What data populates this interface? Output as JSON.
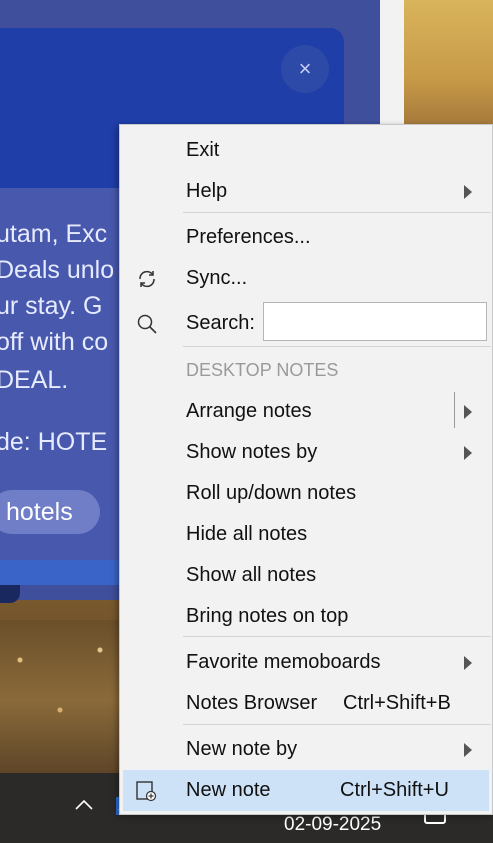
{
  "background": {
    "promo_lines": [
      "utam, Exc",
      "Deals unlo",
      "ur stay. G",
      "off with co",
      "DEAL.",
      "de: HOTE"
    ],
    "promo_button": "hotels",
    "close_symbol": "×"
  },
  "taskbar": {
    "date": "02-09-2025",
    "chevron": "^"
  },
  "menu": {
    "items": [
      {
        "label": "Exit"
      },
      {
        "label": "Help",
        "submenu": true
      },
      {
        "label": "Preferences..."
      },
      {
        "label": "Sync...",
        "icon": "sync-icon"
      },
      {
        "label": "Search:",
        "icon": "search-icon"
      },
      {
        "label": "Arrange notes",
        "submenu": true
      },
      {
        "label": "Show notes by",
        "submenu": true
      },
      {
        "label": "Roll up/down notes"
      },
      {
        "label": "Hide all notes"
      },
      {
        "label": "Show all notes"
      },
      {
        "label": "Bring notes on top"
      },
      {
        "label": "Favorite memoboards",
        "submenu": true
      },
      {
        "label": "Notes Browser",
        "shortcut": "Ctrl+Shift+B"
      },
      {
        "label": "New note by",
        "submenu": true
      },
      {
        "label": "New note",
        "shortcut": "Ctrl+Shift+U",
        "icon": "new-note-icon",
        "highlighted": true
      }
    ],
    "section_header": "DESKTOP NOTES",
    "search": {
      "value": "",
      "placeholder": ""
    }
  },
  "colors": {
    "menu_bg": "#f2f2f2",
    "highlight": "#cde1f7",
    "promo_blue": "#1f3ea8",
    "taskbar": "#2b2a28"
  }
}
